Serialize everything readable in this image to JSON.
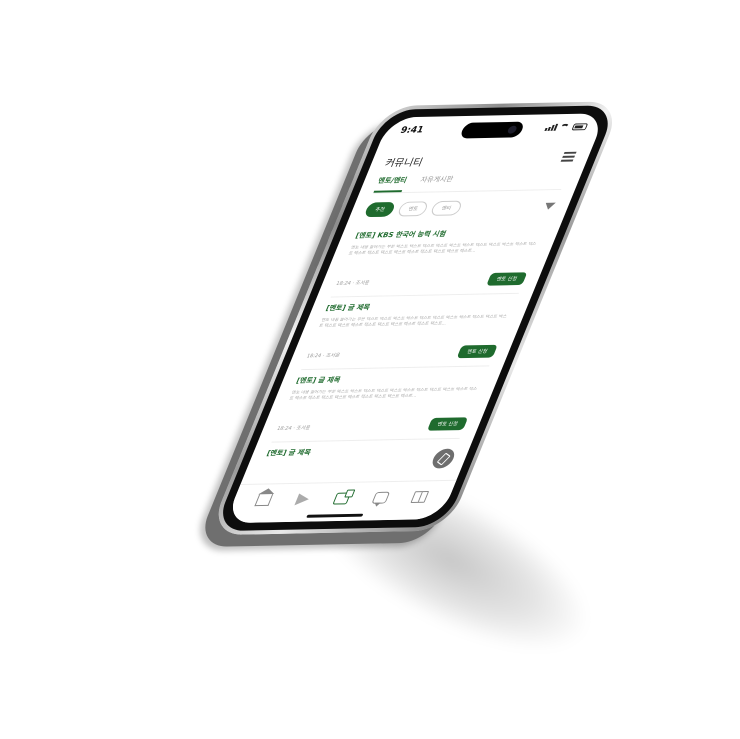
{
  "status": {
    "time": "9:41"
  },
  "header": {
    "title": "커뮤니티",
    "menu_icon": "hamburger-menu-icon"
  },
  "tabs": [
    {
      "label": "멘토/멘티",
      "active": true
    },
    {
      "label": "자유게시판",
      "active": false
    }
  ],
  "filters": [
    {
      "label": "추천",
      "active": true
    },
    {
      "label": "멘토",
      "active": false
    },
    {
      "label": "멘티",
      "active": false
    }
  ],
  "filter_icon": "funnel-icon",
  "posts": [
    {
      "title": "[멘토] KBS 한국어 능력 시험",
      "body": "멘토 내용 들어가는 부분 텍스트 텍스트 텍스트 텍스트 텍스트 텍스트 텍스트 텍스트 텍스트 텍스트 텍스트 텍스트 텍스트 텍스트 텍스트 텍스트 텍스트 텍스트 텍스트 텍스트...",
      "meta": "18:24 · 조서윤",
      "button": "멘토 신청"
    },
    {
      "title": "[멘토] 글 제목",
      "body": "멘토 내용 들어가는 부분 텍스트 텍스트 텍스트 텍스트 텍스트 텍스트 텍스트 텍스트 텍스트 텍스트 텍스트 텍스트 텍스트 텍스트 텍스트 텍스트 텍스트 텍스트 텍스트 텍스트...",
      "meta": "18:24 · 조서윤",
      "button": "멘토 신청"
    },
    {
      "title": "[멘토] 글 제목",
      "body": "멘토 내용 들어가는 부분 텍스트 텍스트 텍스트 텍스트 텍스트 텍스트 텍스트 텍스트 텍스트 텍스트 텍스트 텍스트 텍스트 텍스트 텍스트 텍스트 텍스트 텍스트 텍스트 텍스트...",
      "meta": "18:24 · 조서윤",
      "button": "멘토 신청"
    },
    {
      "title": "[멘토] 글 제목",
      "body": "",
      "meta": "",
      "button": ""
    }
  ],
  "fab_icon": "pencil-icon",
  "bottom_nav": [
    {
      "icon": "home-icon",
      "active": false
    },
    {
      "icon": "send-icon",
      "active": false
    },
    {
      "icon": "community-icon",
      "active": true
    },
    {
      "icon": "chat-icon",
      "active": false
    },
    {
      "icon": "book-icon",
      "active": false
    }
  ],
  "colors": {
    "accent": "#1f6b2e",
    "muted_text": "#aaaaaa",
    "background": "#ffffff"
  }
}
